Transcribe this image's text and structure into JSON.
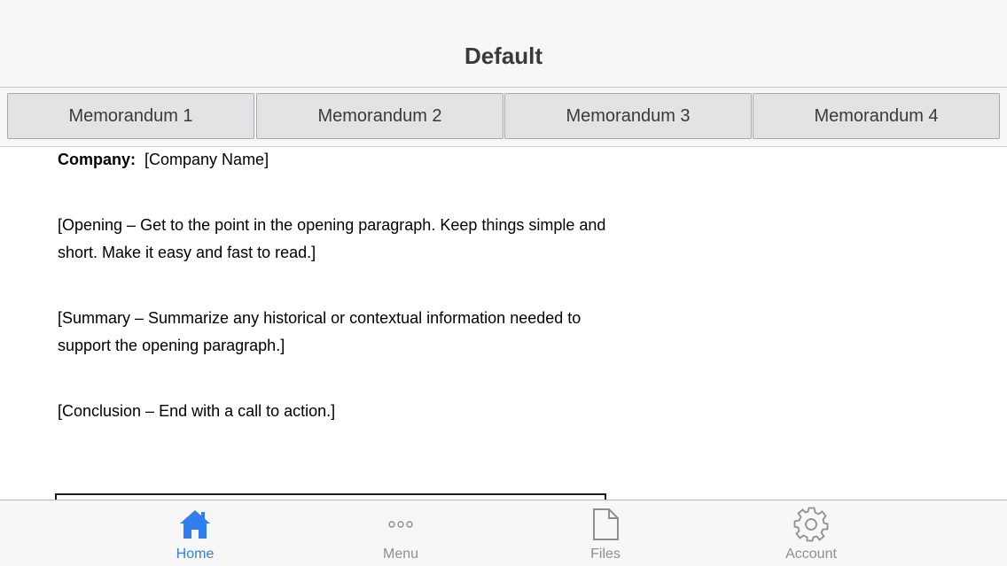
{
  "nav": {
    "title": "Default"
  },
  "tabs": [
    {
      "label": "Memorandum 1"
    },
    {
      "label": "Memorandum 2"
    },
    {
      "label": "Memorandum 3"
    },
    {
      "label": "Memorandum 4"
    }
  ],
  "document": {
    "company_label": "Company:",
    "company_value": "[Company Name]",
    "paragraphs": [
      "[Opening – Get to the point in the opening paragraph. Keep things simple and short. Make it easy and fast to read.]",
      "[Summary – Summarize any historical or contextual information needed to support the opening paragraph.]",
      "[Conclusion – End with a call to action.]"
    ]
  },
  "tabbar": {
    "items": [
      {
        "label": "Home",
        "icon": "home-icon",
        "active": true
      },
      {
        "label": "Menu",
        "icon": "more-icon",
        "active": false
      },
      {
        "label": "Files",
        "icon": "file-icon",
        "active": false
      },
      {
        "label": "Account",
        "icon": "gear-icon",
        "active": false
      }
    ],
    "active_color": "#2f7ff0",
    "inactive_color": "#8e8e93"
  }
}
